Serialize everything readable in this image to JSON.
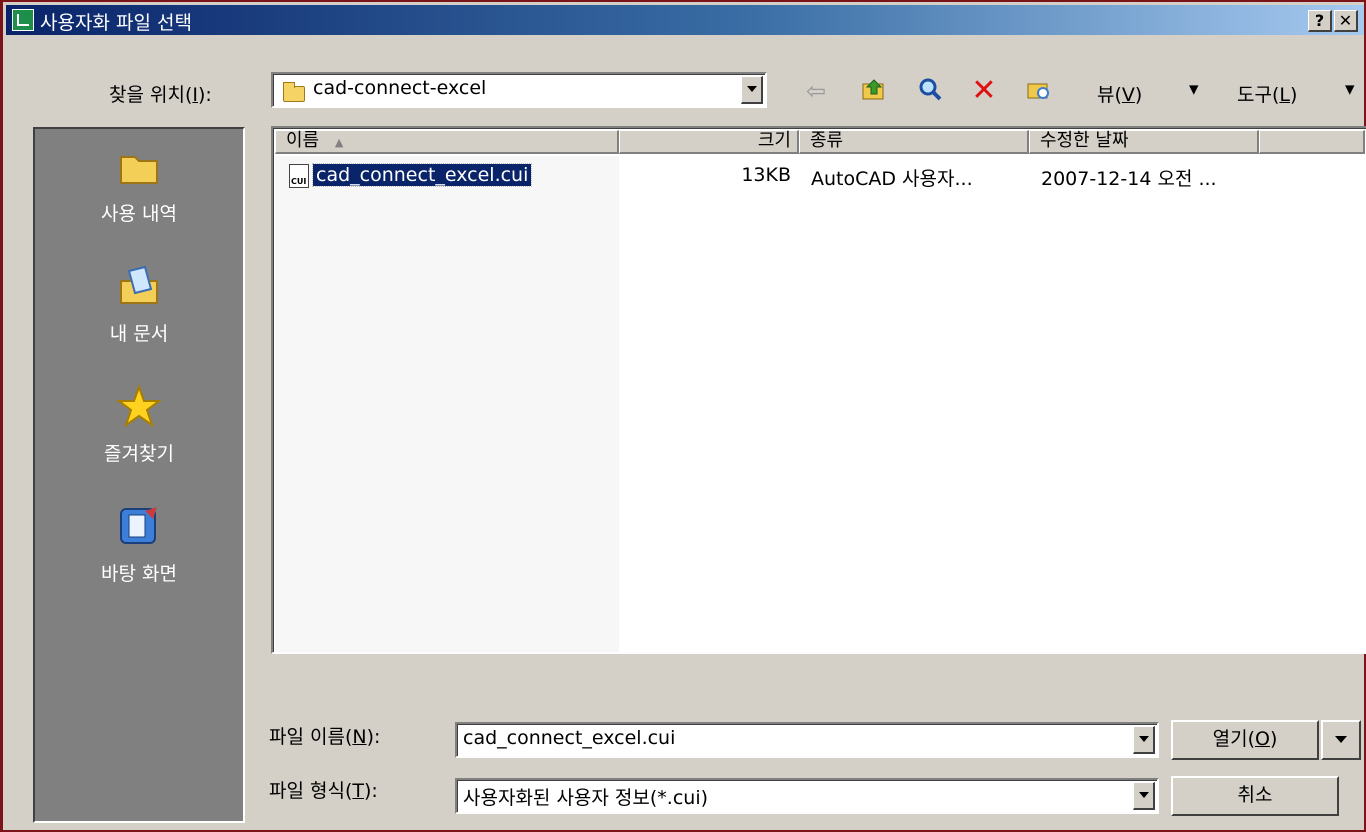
{
  "window": {
    "title": "사용자화 파일 선택",
    "help_btn": "?",
    "close_btn": "✕"
  },
  "lookin": {
    "label_pre": "찾을 위치(",
    "label_key": "I",
    "label_post": "):",
    "value": "cad-connect-excel"
  },
  "toolbar": {
    "view_pre": "뷰(",
    "view_key": "V",
    "view_post": ")",
    "tools_pre": "도구(",
    "tools_key": "L",
    "tools_post": ")",
    "arrow": "▾"
  },
  "places": [
    {
      "label": "사용 내역",
      "icon": "history-folder-icon"
    },
    {
      "label": "내 문서",
      "icon": "my-documents-icon"
    },
    {
      "label": "즐겨찾기",
      "icon": "favorites-star-icon"
    },
    {
      "label": "바탕 화면",
      "icon": "desktop-icon"
    }
  ],
  "filelist": {
    "columns": {
      "name": "이름",
      "sort_arrow": "▲",
      "size": "크기",
      "type": "종류",
      "modified": "수정한 날짜"
    },
    "rows": [
      {
        "name": "cad_connect_excel.cui",
        "size": "13KB",
        "type": "AutoCAD 사용자...",
        "modified": "2007-12-14 오전 ...",
        "icon_text": "CUI"
      }
    ]
  },
  "filename": {
    "label_pre": "파일 이름(",
    "label_key": "N",
    "label_post": "):",
    "value": "cad_connect_excel.cui"
  },
  "filetype": {
    "label_pre": "파일 형식(",
    "label_key": "T",
    "label_post": "):",
    "value": "사용자화된 사용자 정보(*.cui)"
  },
  "buttons": {
    "open_pre": "열기(",
    "open_key": "O",
    "open_post": ")",
    "cancel": "취소"
  },
  "colors": {
    "titlebar_start": "#0a246a",
    "titlebar_end": "#a6caf0",
    "selection": "#0a246a",
    "places_bg": "#808080"
  }
}
